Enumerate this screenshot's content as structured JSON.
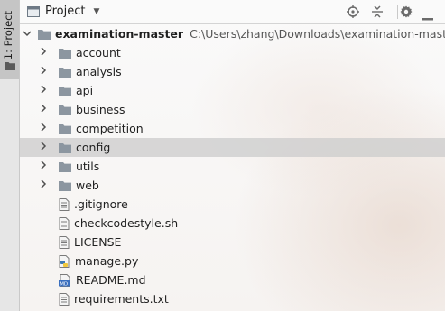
{
  "sidebar": {
    "tab_label": "1: Project"
  },
  "header": {
    "title": "Project"
  },
  "tree": {
    "root": {
      "name": "examination-master",
      "path": "C:\\Users\\zhang\\Downloads\\examination-master\\ex"
    },
    "folders": [
      {
        "label": "account"
      },
      {
        "label": "analysis"
      },
      {
        "label": "api"
      },
      {
        "label": "business"
      },
      {
        "label": "competition"
      },
      {
        "label": "config"
      },
      {
        "label": "utils"
      },
      {
        "label": "web"
      }
    ],
    "files": [
      {
        "label": ".gitignore",
        "icon": "text-file-icon"
      },
      {
        "label": "checkcodestyle.sh",
        "icon": "text-file-icon"
      },
      {
        "label": "LICENSE",
        "icon": "text-file-icon"
      },
      {
        "label": "manage.py",
        "icon": "python-file-icon"
      },
      {
        "label": "README.md",
        "icon": "markdown-file-icon"
      },
      {
        "label": "requirements.txt",
        "icon": "text-file-icon"
      }
    ],
    "selected_item": "config"
  },
  "colors": {
    "selection": "#cdcdcd",
    "folder": "#8c96a0",
    "python_blue": "#3c78b4",
    "python_yellow": "#f0c83c",
    "markdown_badge": "#3a6fbf"
  },
  "icons": [
    "folder-icon",
    "locate-icon",
    "collapse-all-icon",
    "gear-icon",
    "minimize-icon"
  ]
}
